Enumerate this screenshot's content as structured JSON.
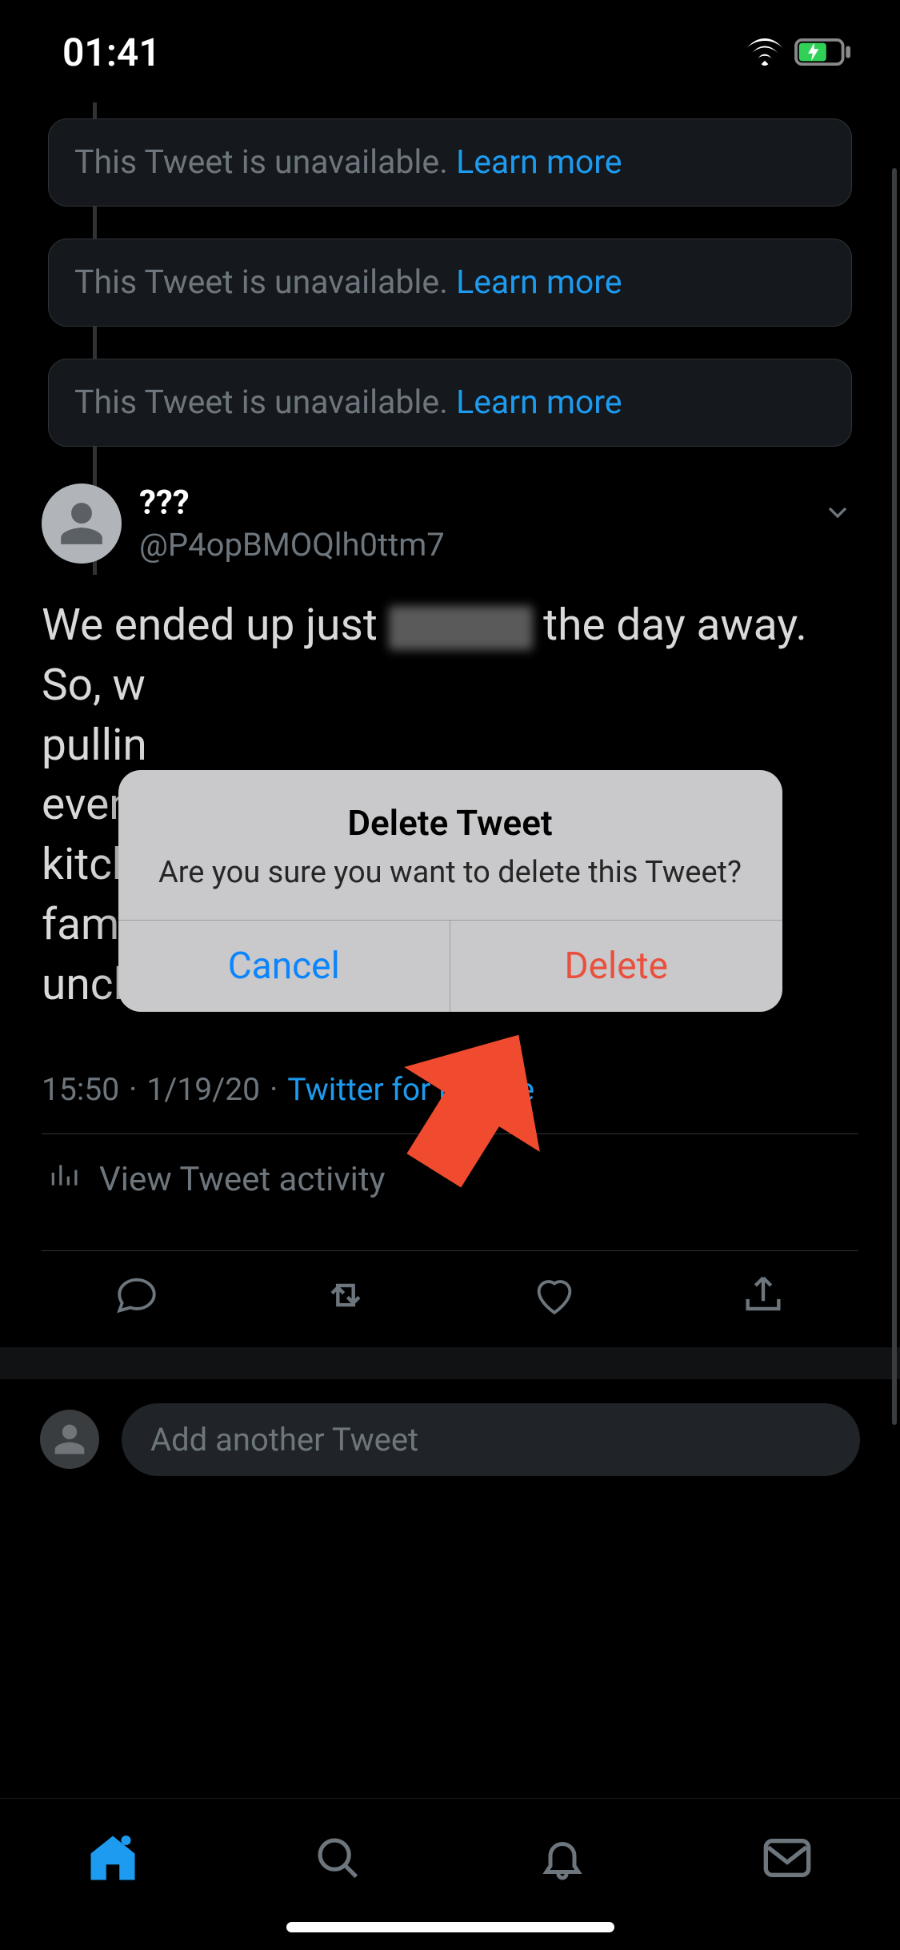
{
  "status": {
    "time": "01:41"
  },
  "unavailable": {
    "text": "This Tweet is unavailable.",
    "learn_more": "Learn more"
  },
  "tweet": {
    "display_name": "???",
    "handle": "@P4opBMOQlh0ttm7",
    "body_prefix": "We ended up just ",
    "body_mid": "the day away. So, w",
    "body_line3": "pullin",
    "body_line4": "even",
    "body_line5": "kitch",
    "body_line6": "fami",
    "body_line7": "uncle's.",
    "time": "15:50",
    "date": "1/19/20",
    "source": "Twitter for iPhone",
    "activity_label": "View Tweet activity"
  },
  "compose": {
    "placeholder": "Add another Tweet"
  },
  "alert": {
    "title": "Delete Tweet",
    "message": "Are you sure you want to delete this Tweet?",
    "cancel": "Cancel",
    "delete": "Delete"
  }
}
